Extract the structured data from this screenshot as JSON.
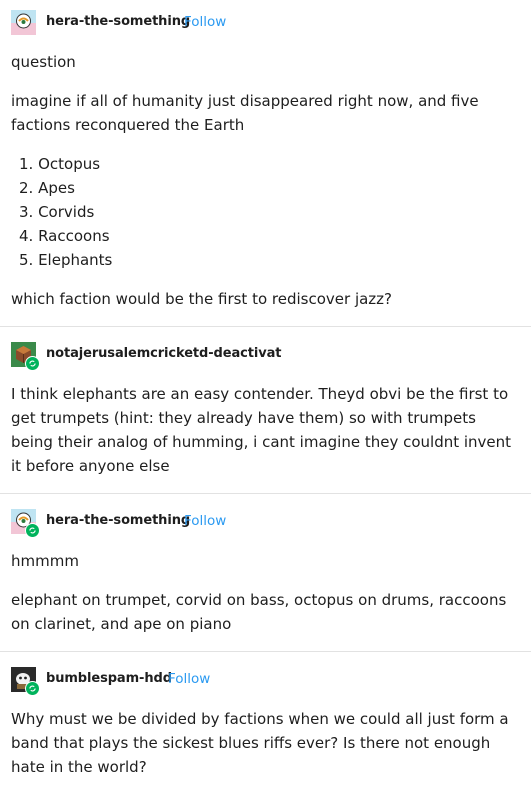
{
  "posts": [
    {
      "username": "hera-the-something",
      "follow": "Follow",
      "title": "question",
      "body": "imagine if all of humanity just disappeared right now, and five factions reconquered the Earth",
      "list": [
        "1. Octopus",
        "2. Apes",
        "3. Corvids",
        "4. Raccoons",
        "5. Elephants"
      ],
      "question": "which faction would be the first to rediscover jazz?"
    },
    {
      "username": "notajerusalemcricketd-deactivat",
      "body": "I think elephants are an easy contender. Theyd obvi be the first to get trumpets (hint: they already have them) so with trumpets being their analog of humming, i cant imagine they couldnt invent it before anyone else"
    },
    {
      "username": "hera-the-something",
      "follow": "Follow",
      "line1": "hmmmm",
      "body": "elephant on trumpet, corvid on bass, octopus on drums, raccoons on clarinet, and ape on piano"
    },
    {
      "username": "bumblespam-hdd",
      "follow": "Follow",
      "body": "Why must we be divided by factions when we could all just form a band that plays the sickest blues riffs ever? Is there not enough hate in the world?"
    }
  ],
  "colors": {
    "follow": "#2b9af1",
    "reblog": "#00b35c",
    "divider": "#e2e2e2"
  },
  "icons": [
    "reblog-icon"
  ]
}
